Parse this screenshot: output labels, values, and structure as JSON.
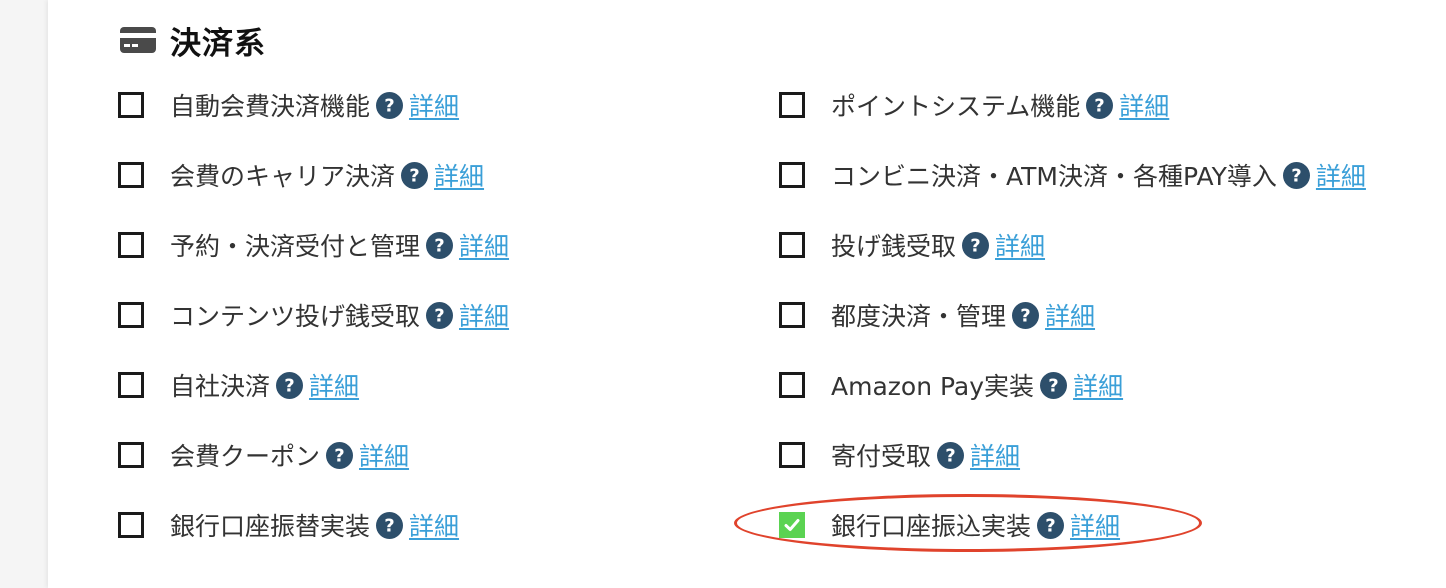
{
  "section": {
    "icon": "credit-card-icon",
    "title": "決済系"
  },
  "colors": {
    "checked_fill": "#5bd352",
    "link": "#3a9fd8",
    "help_icon": "#2d4f6b",
    "highlight": "#e0432c"
  },
  "detail_label": "詳細",
  "left_items": [
    {
      "label": "自動会費決済機能",
      "checked": false
    },
    {
      "label": "会費のキャリア決済",
      "checked": false
    },
    {
      "label": "予約・決済受付と管理",
      "checked": false
    },
    {
      "label": "コンテンツ投げ銭受取",
      "checked": false
    },
    {
      "label": "自社決済",
      "checked": false
    },
    {
      "label": "会費クーポン",
      "checked": false
    },
    {
      "label": "銀行口座振替実装",
      "checked": false
    }
  ],
  "right_items": [
    {
      "label": "ポイントシステム機能",
      "checked": false
    },
    {
      "label": "コンビニ決済・ATM決済・各種PAY導入",
      "checked": false
    },
    {
      "label": "投げ銭受取",
      "checked": false
    },
    {
      "label": "都度決済・管理",
      "checked": false
    },
    {
      "label": "Amazon Pay実装",
      "checked": false
    },
    {
      "label": "寄付受取",
      "checked": false
    },
    {
      "label": "銀行口座振込実装",
      "checked": true
    }
  ]
}
